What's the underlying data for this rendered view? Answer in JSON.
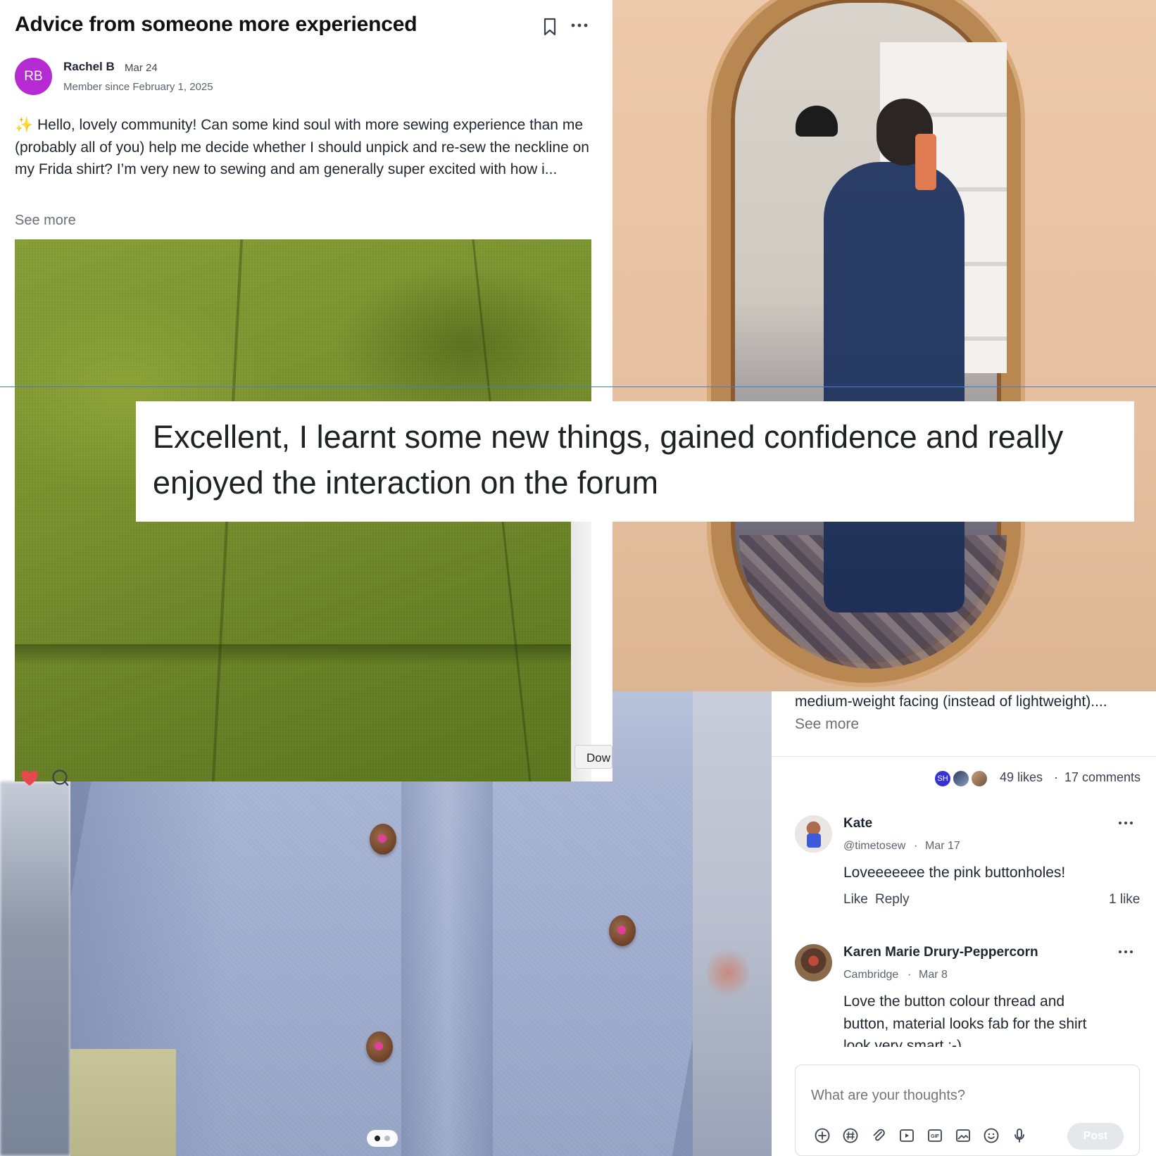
{
  "post": {
    "title": "Advice from someone more experienced",
    "author": {
      "initials": "RB",
      "name": "Rachel B",
      "date": "Mar 24",
      "member_since": "Member since February 1, 2025",
      "avatar_color": "#b62ad1"
    },
    "body": "✨ Hello, lovely community! Can some kind soul with more sewing experience than me (probably all of you) help me decide whether I should unpick and re-sew the neckline on my Frida shirt? I’m very new to sewing and am generally super excited with how i...",
    "see_more": "See more",
    "icons": [
      "bookmark-icon",
      "more-icon"
    ]
  },
  "download_button": "Dow",
  "quote": "Excellent, I learnt some new things, gained confidence and really enjoyed the interaction on the forum",
  "image_pager": {
    "count": 2,
    "active": 0
  },
  "comments_panel": {
    "truncated_body": "medium-weight facing (instead of lightweight)....",
    "see_more": "See more",
    "likers": [
      "SH"
    ],
    "likes": "49 likes",
    "separator": "·",
    "comments_count": "17 comments",
    "heart_color": "#e5484d",
    "comments": [
      {
        "name": "Kate",
        "handle": "@timetosew",
        "date": "Mar 17",
        "text": "Loveeeeeee the pink buttonholes!",
        "like_label": "Like",
        "reply_label": "Reply",
        "like_count": "1 like"
      },
      {
        "name": "Karen Marie Drury-Peppercorn",
        "handle": "Cambridge",
        "date": "Mar 8",
        "text": "Love the button colour thread and button, material looks fab for the shirt look very smart :-)"
      }
    ],
    "compose": {
      "placeholder": "What are your thoughts?",
      "post_label": "Post",
      "tools": [
        "plus-icon",
        "hashtag-icon",
        "attachment-icon",
        "video-icon",
        "gif-icon",
        "image-icon",
        "emoji-icon",
        "microphone-icon"
      ]
    }
  }
}
